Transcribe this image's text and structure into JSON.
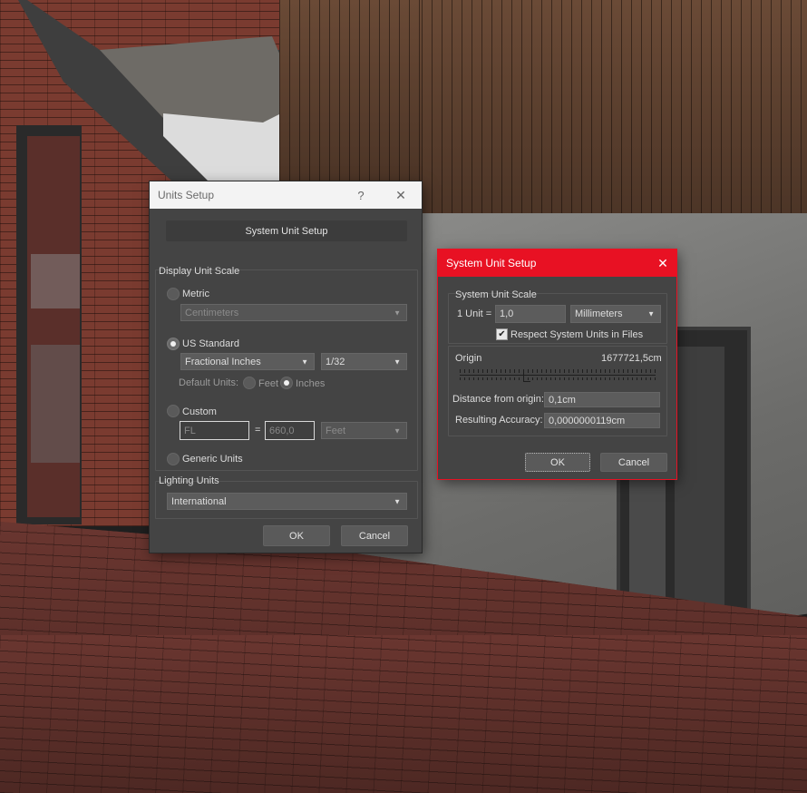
{
  "units_dialog": {
    "title": "Units Setup",
    "help_glyph": "?",
    "close_glyph": "✕",
    "system_unit_setup_button": "System Unit Setup",
    "display_unit_scale": {
      "group_label": "Display Unit Scale",
      "metric": {
        "label": "Metric",
        "selected_value": "Centimeters"
      },
      "us_standard": {
        "label": "US Standard",
        "type_value": "Fractional Inches",
        "fraction_value": "1/32",
        "default_units_label": "Default Units:",
        "feet_label": "Feet",
        "inches_label": "Inches"
      },
      "custom": {
        "label": "Custom",
        "name_value": "FL",
        "equals": "=",
        "amount_value": "660,0",
        "unit_value": "Feet"
      },
      "generic_units": {
        "label": "Generic Units"
      }
    },
    "lighting_units": {
      "group_label": "Lighting Units",
      "value": "International"
    },
    "ok_label": "OK",
    "cancel_label": "Cancel"
  },
  "system_dialog": {
    "title": "System Unit Setup",
    "close_glyph": "✕",
    "scale": {
      "group_label": "System Unit Scale",
      "one_unit_label": "1 Unit =",
      "value": "1,0",
      "unit": "Millimeters"
    },
    "respect_label": "Respect System Units in Files",
    "respect_checked": true,
    "origin_label": "Origin",
    "origin_value": "1677721,5cm",
    "distance_label": "Distance from origin:",
    "distance_value": "0,1cm",
    "accuracy_label": "Resulting Accuracy:",
    "accuracy_value": "0,0000000119cm",
    "ok_label": "OK",
    "cancel_label": "Cancel"
  },
  "icons": {
    "dropdown": "triangle-down-icon",
    "check": "checkmark-icon"
  },
  "colors": {
    "accent_titlebar": "#e81123",
    "dialog_bg": "#444444"
  }
}
